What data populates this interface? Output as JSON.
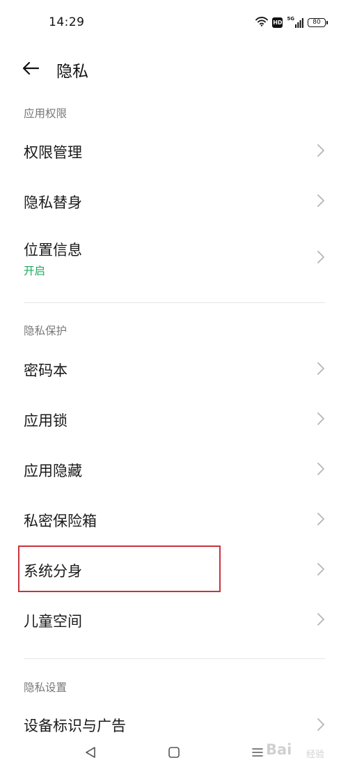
{
  "status_bar": {
    "time": "14:29",
    "network": "5G",
    "hd_label": "HD",
    "battery": "80",
    "icons": [
      "wifi-icon",
      "hd-icon",
      "signal-5g-icon",
      "battery-icon"
    ]
  },
  "header": {
    "title": "隐私",
    "back_icon": "back-arrow-icon"
  },
  "sections": {
    "app_permissions": {
      "title": "应用权限",
      "items": [
        {
          "label": "权限管理"
        },
        {
          "label": "隐私替身"
        },
        {
          "label": "位置信息",
          "sub": "开启"
        }
      ]
    },
    "privacy_protection": {
      "title": "隐私保护",
      "items": [
        {
          "label": "密码本"
        },
        {
          "label": "应用锁"
        },
        {
          "label": "应用隐藏"
        },
        {
          "label": "私密保险箱"
        },
        {
          "label": "系统分身"
        },
        {
          "label": "儿童空间"
        }
      ]
    },
    "privacy_settings": {
      "title": "隐私设置",
      "items": [
        {
          "label": "设备标识与广告"
        }
      ]
    }
  },
  "nav_bar": {
    "icons": [
      "back-triangle-icon",
      "home-square-icon",
      "menu-lines-icon"
    ]
  },
  "colors": {
    "accent_green": "#1aab5c",
    "highlight_red": "#c8323c",
    "section_gray": "#777777"
  }
}
